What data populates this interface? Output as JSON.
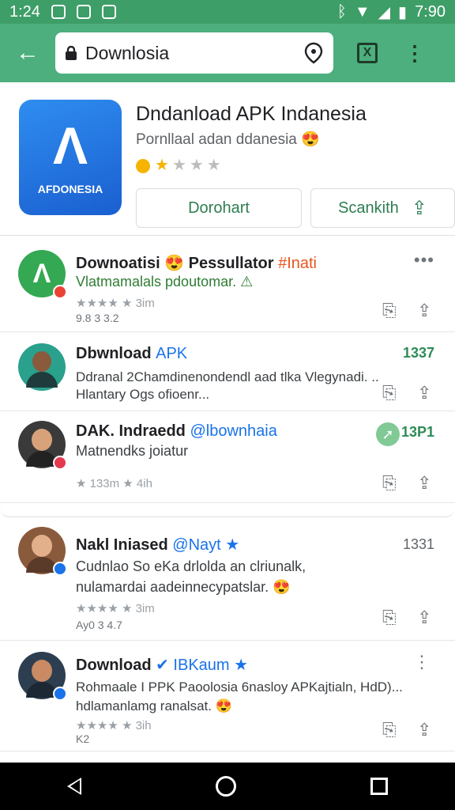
{
  "status_bar": {
    "time_left": "1:24",
    "time_right": "7:90"
  },
  "toolbar": {
    "url": "Downlosia"
  },
  "app": {
    "icon_label": "AFDONESIA",
    "title": "Dndanload APK Indanesia",
    "subtitle": "Pornllaal adan ddanesia 😍",
    "rating_stars": 1,
    "download_label": "Dorohart",
    "search_label": "Scankith"
  },
  "feed": [
    {
      "name": "Downoatisi 😍 Pessullator",
      "handle": "#Inati",
      "handle_color": "#e8541c",
      "body": [
        "Vlatmamalals pdoutomar. ⚠"
      ],
      "body_color": "#2e7d32",
      "meta": "★★★★ ★ 3im",
      "foot": "9.8 3 3.2",
      "right": "",
      "avatar_bg": "#34a853",
      "dot_color": "#ea4335"
    },
    {
      "name": "Dbwnload",
      "handle": "APK",
      "handle_color": "#1a73e8",
      "body": [
        "Ddranal 2Chamdinenondendl aad tlka Vlegynadi. ..",
        "Hlantary Ogs ofioenr..."
      ],
      "body_color": "#3c4043",
      "meta": "",
      "foot": "",
      "right": "1337",
      "avatar_bg": "#2aa18c",
      "dot_color": ""
    },
    {
      "name": "DAK. Indraedd",
      "handle": "@lbownhaia",
      "handle_color": "#1a73e8",
      "body": [
        "Matnendks joiatur"
      ],
      "body_color": "#202124",
      "meta": "★ 133m ★ 4ih",
      "foot": "",
      "right": "13P1",
      "avatar_bg": "#3a3a3a",
      "dot_color": "#e53950"
    },
    {
      "name": "Nakl Iniased",
      "handle": "@Nayt ★",
      "handle_color": "#1a73e8",
      "body": [
        "Cudnlao So eKa drlolda an clriunalk,",
        "nulamardai aadeinnecypatslar. 😍"
      ],
      "body_color": "#202124",
      "meta": "★★★★ ★ 3im",
      "foot": "Ay0 3 4.7",
      "right": "1331",
      "avatar_bg": "#8a5a3c",
      "dot_color": "#1a73e8"
    },
    {
      "name": "Download",
      "handle": "✔ IBKaum ★",
      "handle_color": "#1a73e8",
      "body": [
        "Rohmaale I PPK Paoolosia 6nasloy APKajtialn, HdD)...",
        "hdlamanlamg ranalsat. 😍"
      ],
      "body_color": "#3c4043",
      "meta": "★★★★ ★ 3ih",
      "foot": "K2",
      "right": "",
      "avatar_bg": "#2c3e50",
      "dot_color": "#1a73e8"
    }
  ]
}
